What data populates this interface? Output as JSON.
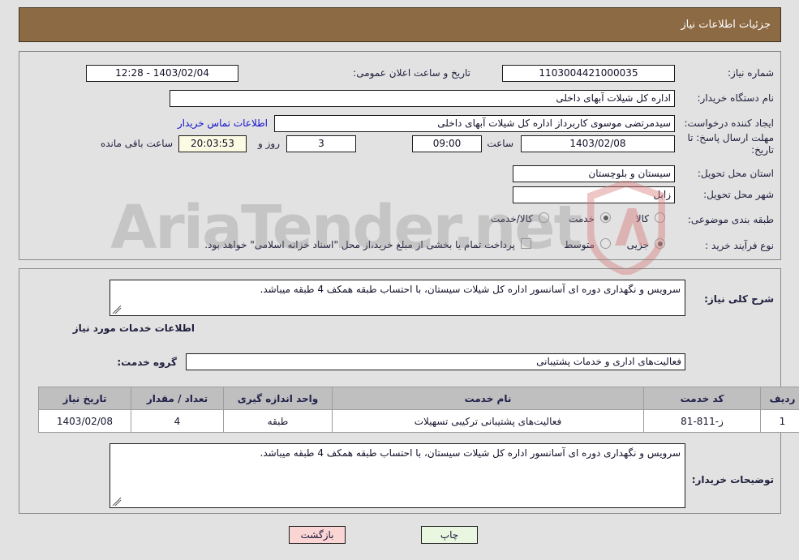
{
  "header": {
    "title": "جزئیات اطلاعات نیاز"
  },
  "watermark": {
    "text": "AriaTender.net"
  },
  "top_panel": {
    "need_number_label": "شماره نیاز:",
    "need_number_value": "1103004421000035",
    "announce_datetime_label": "تاریخ و ساعت اعلان عمومی:",
    "announce_datetime_value": "1403/02/04 - 12:28",
    "buyer_org_label": "نام دستگاه خریدار:",
    "buyer_org_value": "اداره کل شیلات آبهای داخلی",
    "requester_label": "ایجاد کننده درخواست:",
    "requester_value": "سیدمرتضی موسوی کاربرداز اداره کل شیلات آبهای داخلی",
    "buyer_contact_link": "اطلاعات تماس خریدار",
    "deadline_label": "مهلت ارسال پاسخ: تا تاریخ:",
    "deadline_date": "1403/02/08",
    "deadline_hour_label": "ساعت",
    "deadline_hour_value": "09:00",
    "remaining_days_value": "3",
    "remaining_days_label": "روز و",
    "remaining_time_value": "20:03:53",
    "remaining_time_label": "ساعت باقی مانده",
    "province_label": "استان محل تحویل:",
    "province_value": "سیستان و بلوچستان",
    "city_label": "شهر محل تحویل:",
    "city_value": "زابل",
    "category_label": "طبقه بندی موضوعی:",
    "category_options": [
      {
        "label": "کالا",
        "selected": false
      },
      {
        "label": "خدمت",
        "selected": true
      },
      {
        "label": "کالا/خدمت",
        "selected": false
      }
    ],
    "purchase_type_label": "نوع فرآیند خرید :",
    "purchase_type_options": [
      {
        "label": "جزیی",
        "selected": true
      },
      {
        "label": "متوسط",
        "selected": false
      }
    ],
    "treasury_checkbox_checked": false,
    "treasury_note": "پرداخت تمام یا بخشی از مبلغ خرید،از محل \"اسناد خزانه اسلامی\" خواهد بود."
  },
  "bottom_panel": {
    "general_desc_label": "شرح کلی نیاز:",
    "general_desc_value": "سرویس و نگهداری دوره ای آسانسور اداره کل شیلات سیستان، با احتساب طبقه همکف 4 طبقه میباشد.",
    "services_info_heading": "اطلاعات خدمات مورد نیاز",
    "service_group_label": "گروه خدمت:",
    "service_group_value": "فعالیت‌های اداری و خدمات پشتیبانی",
    "table": {
      "headers": [
        "ردیف",
        "کد خدمت",
        "نام خدمت",
        "واحد اندازه گیری",
        "تعداد / مقدار",
        "تاریخ نیاز"
      ],
      "rows": [
        {
          "row_no": "1",
          "service_code": "ز-811-81",
          "service_name": "فعالیت‌های پشتیبانی ترکیبی تسهیلات",
          "unit": "طبقه",
          "quantity": "4",
          "need_date": "1403/02/08"
        }
      ]
    },
    "buyer_notes_label": "توضیحات خریدار:",
    "buyer_notes_value": "سرویس و نگهداری دوره ای آسانسور اداره کل شیلات سیستان، با احتساب طبقه همکف 4 طبقه میباشد."
  },
  "footer": {
    "back_button": "بازگشت",
    "print_button": "چاپ"
  },
  "colors": {
    "header_bg": "#8c6a43",
    "panel_border": "#8a8a8a",
    "table_header_bg": "#bfbfbf",
    "link": "#1010cf",
    "back_button_bg": "#fbd4d4",
    "print_button_bg": "#e9f7e0",
    "timer_bg": "#fbfbe4",
    "page_bg": "#e2e2e2"
  }
}
